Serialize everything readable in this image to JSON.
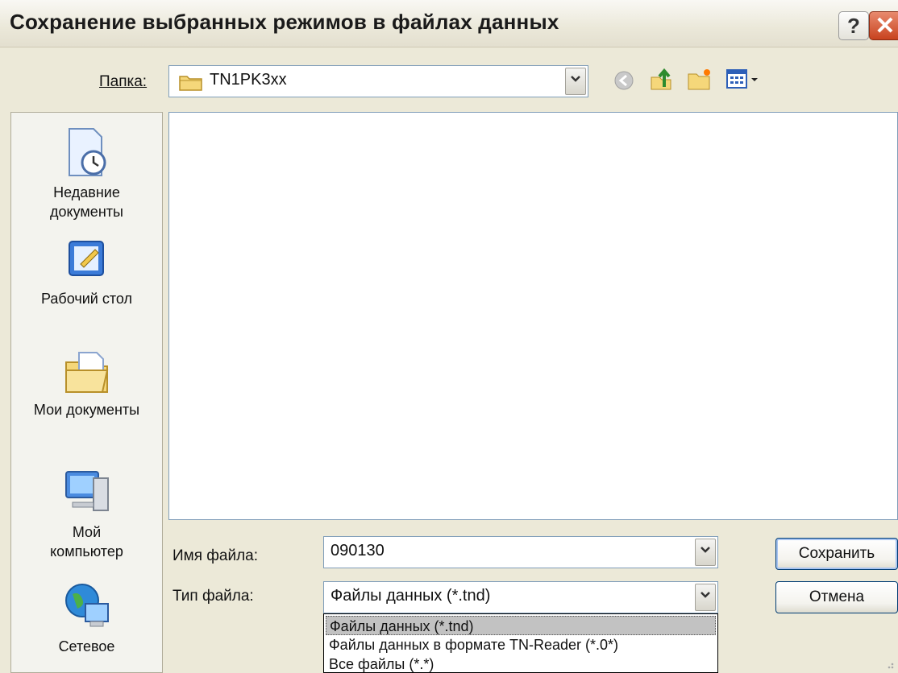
{
  "window": {
    "title": "Сохранение выбранных режимов в файлах данных"
  },
  "folder": {
    "label": "Папка:",
    "value": "TN1PK3xx"
  },
  "places": [
    {
      "label": "Недавние документы"
    },
    {
      "label": "Рабочий стол"
    },
    {
      "label": "Мои документы"
    },
    {
      "label": "Мой компьютер"
    },
    {
      "label": "Сетевое"
    }
  ],
  "filename": {
    "label": "Имя файла:",
    "value": "090130"
  },
  "filetype": {
    "label": "Тип файла:",
    "value": "Файлы данных (*.tnd)",
    "options": [
      "Файлы данных (*.tnd)",
      "Файлы данных в формате TN-Reader (*.0*)",
      "Все файлы (*.*)"
    ],
    "selected_index": 0
  },
  "buttons": {
    "save": "Сохранить",
    "cancel": "Отмена"
  }
}
